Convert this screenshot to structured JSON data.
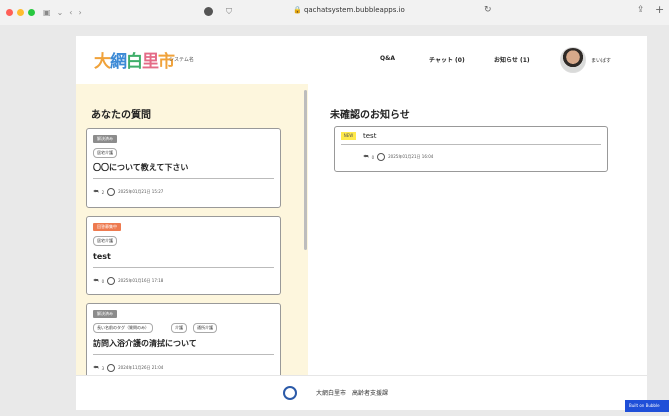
{
  "browser": {
    "url": "qachatsystem.bubbleapps.io",
    "traffic_colors": [
      "#ff5f57",
      "#febc2e",
      "#28c840"
    ]
  },
  "header": {
    "logo": [
      "大",
      "網",
      "白",
      "里",
      "市"
    ],
    "system_name": "システム名",
    "nav": {
      "qa": "Q&A",
      "chat": "チャット (0)",
      "notice": "お知らせ (1)"
    },
    "username": "まいばす"
  },
  "left": {
    "title": "あなたの質問",
    "questions": [
      {
        "status": "解決済み",
        "status_color": "#8c8c8c",
        "tags": [
          "居宅介護"
        ],
        "title": "〇〇について教えて下さい",
        "replies": "2",
        "date": "2025年01月21日 15:27"
      },
      {
        "status": "回答募集中",
        "status_color": "#ee7a4f",
        "tags": [
          "居宅介護"
        ],
        "title": "test",
        "replies": "0",
        "date": "2025年01月16日 17:18"
      },
      {
        "status": "解決済み",
        "status_color": "#8c8c8c",
        "tags": [
          "長い名前のタグ（質問のみ）",
          "介護",
          "通所介護"
        ],
        "title": "訪問入浴介護の清拭について",
        "replies": "3",
        "date": "2024年11月26日 21:04"
      }
    ]
  },
  "right": {
    "title": "未確認のお知らせ",
    "notices": [
      {
        "badge": "NEW",
        "title": "test",
        "replies": "0",
        "date": "2025年01月21日 16:04"
      }
    ]
  },
  "footer": {
    "text": "大網白里市　高齢者支援課"
  },
  "bubble_badge": "Built on Bubble"
}
